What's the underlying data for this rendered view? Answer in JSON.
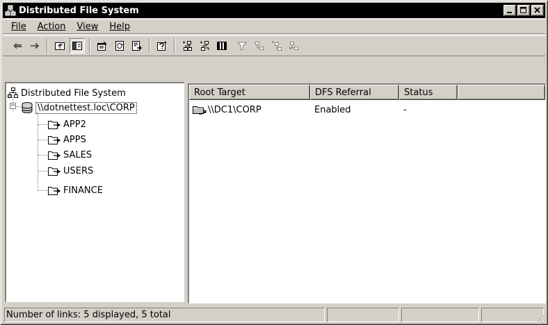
{
  "window": {
    "title": "Distributed File System",
    "icon": "dfs-app-icon"
  },
  "caption_buttons": [
    "minimize",
    "maximize",
    "close"
  ],
  "menu": [
    {
      "label": "File"
    },
    {
      "label": "Action"
    },
    {
      "label": "View"
    },
    {
      "label": "Help"
    }
  ],
  "toolbar": {
    "icons": [
      "back-arrow",
      "forward-arrow",
      "up-folder",
      "show-hide-console-tree",
      "properties",
      "refresh",
      "export-list",
      "help",
      "new-root",
      "new-link",
      "show-status",
      "filter",
      "replication",
      "add-target",
      "remove-target"
    ]
  },
  "tree": {
    "root_label": "Distributed File System",
    "dfs_root": "\\\\dotnettest.loc\\CORP",
    "links": [
      {
        "label": "APP2"
      },
      {
        "label": "APPS"
      },
      {
        "label": "SALES"
      },
      {
        "label": "USERS"
      },
      {
        "label": "FINANCE"
      }
    ]
  },
  "list": {
    "columns": [
      {
        "label": "Root Target"
      },
      {
        "label": "DFS Referral"
      },
      {
        "label": "Status"
      },
      {
        "label": ""
      }
    ],
    "rows": [
      {
        "target": "\\\\DC1\\CORP",
        "referral": "Enabled",
        "status": "-"
      }
    ]
  },
  "status_bar": {
    "text": "Number of links: 5 displayed, 5 total"
  },
  "colors": {
    "titlebar_bg": "#000000",
    "chrome": "#d4d0c8",
    "pane_bg": "#ffffff"
  }
}
